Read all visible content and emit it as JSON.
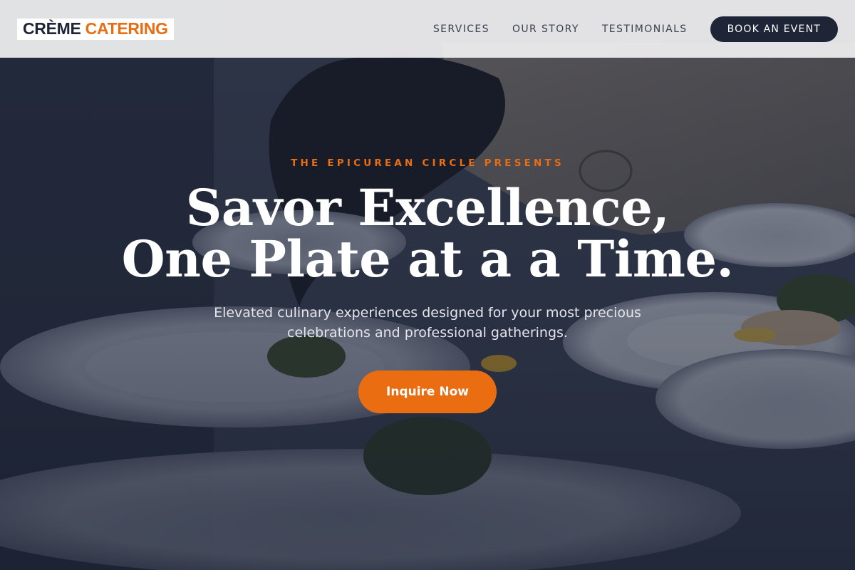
{
  "brand": {
    "name_part1": "CRÈME",
    "name_part2": "CATERING",
    "colors": {
      "navy": "#1d2536",
      "accent": "#ea6d12"
    }
  },
  "nav": {
    "links": [
      "SERVICES",
      "OUR STORY",
      "TESTIMONIALS"
    ],
    "cta_label": "BOOK AN EVENT"
  },
  "hero": {
    "eyebrow": "THE EPICUREAN CIRCLE PRESENTS",
    "headline_lines": [
      "Savor Excellence,",
      "One Plate at a a Time."
    ],
    "subtext_lines": [
      "Elevated culinary experiences designed for your most precious",
      "celebrations and professional gatherings."
    ],
    "cta_label": "Inquire Now"
  }
}
